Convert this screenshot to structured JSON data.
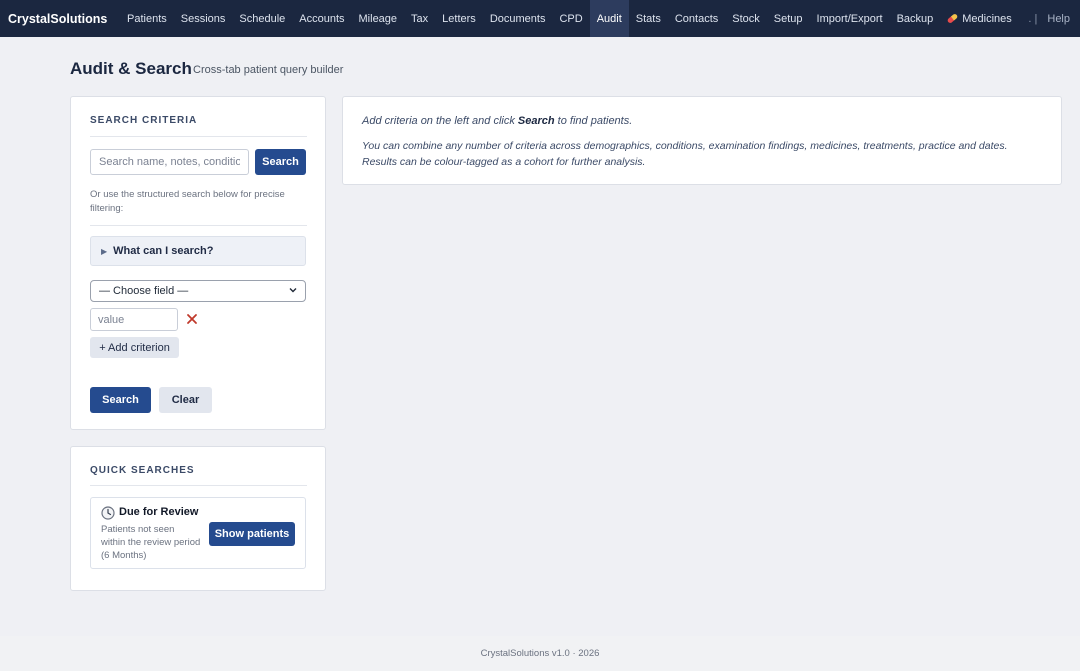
{
  "app": {
    "brand": "CrystalSolutions"
  },
  "nav": {
    "items": [
      {
        "label": "Patients"
      },
      {
        "label": "Sessions"
      },
      {
        "label": "Schedule"
      },
      {
        "label": "Accounts"
      },
      {
        "label": "Mileage"
      },
      {
        "label": "Tax"
      },
      {
        "label": "Letters"
      },
      {
        "label": "Documents"
      },
      {
        "label": "CPD"
      },
      {
        "label": "Audit",
        "active": true
      },
      {
        "label": "Stats"
      },
      {
        "label": "Contacts"
      },
      {
        "label": "Stock"
      },
      {
        "label": "Setup"
      },
      {
        "label": "Import/Export"
      },
      {
        "label": "Backup"
      }
    ],
    "medicines_label": "Medicines",
    "medicines_icon": "pill-icon",
    "separator": ". |",
    "help_label": "Help"
  },
  "header": {
    "title": "Audit & Search",
    "subtitle": "Cross-tab patient query builder"
  },
  "criteria": {
    "heading": "Search Criteria",
    "search_placeholder": "Search name, notes, conditions...",
    "search_button": "Search",
    "hint": "Or use the structured search below for precise filtering:",
    "help_toggle": "What can I search?",
    "field_select": "— Choose field —",
    "value_placeholder": "value",
    "add_button": "+ Add criterion",
    "search_main_button": "Search",
    "clear_button": "Clear"
  },
  "quick": {
    "heading": "Quick Searches",
    "items": [
      {
        "title": "Due for Review",
        "icon": "clock-icon",
        "description": "Patients not seen within the review period (6 Months)",
        "button": "Show patients"
      }
    ]
  },
  "info": {
    "line1_pre": "Add criteria on the left and click ",
    "line1_bold": "Search",
    "line1_post": " to find patients.",
    "line2": "You can combine any number of criteria across demographics, conditions, examination findings, medicines, treatments, practice and dates. Results can be colour-tagged as a cohort for further analysis."
  },
  "footer": {
    "text": "CrystalSolutions v1.0 · 2026"
  },
  "colors": {
    "nav_bg": "#1b2740",
    "primary": "#254b8f",
    "page_bg": "#eff0f4",
    "remove": "#c0392b"
  }
}
